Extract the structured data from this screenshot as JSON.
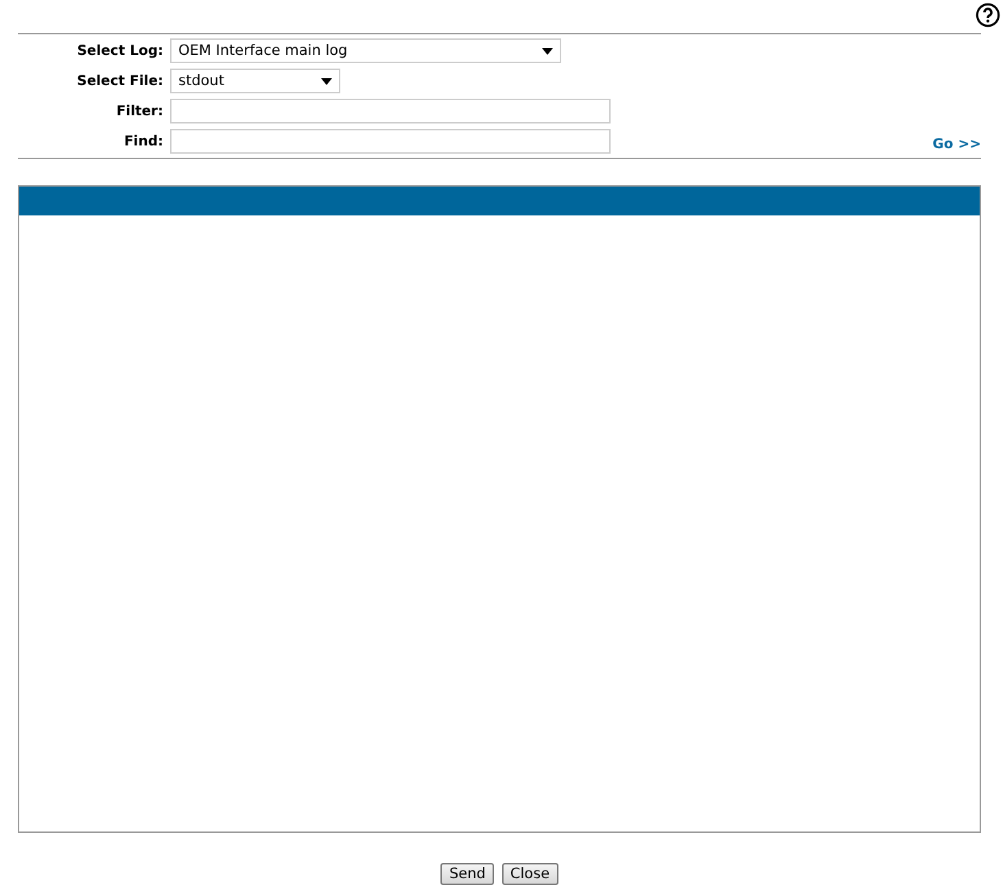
{
  "form": {
    "fields": [
      {
        "kind": "select",
        "label": "Select Log:",
        "value": "OEM Interface main log"
      },
      {
        "kind": "select",
        "label": "Select File:",
        "value": "stdout"
      },
      {
        "kind": "input",
        "label": "Filter:"
      },
      {
        "kind": "input",
        "label": "Find:"
      }
    ],
    "go_link": "Go >>"
  },
  "buttons": [
    "Send",
    "Close"
  ]
}
